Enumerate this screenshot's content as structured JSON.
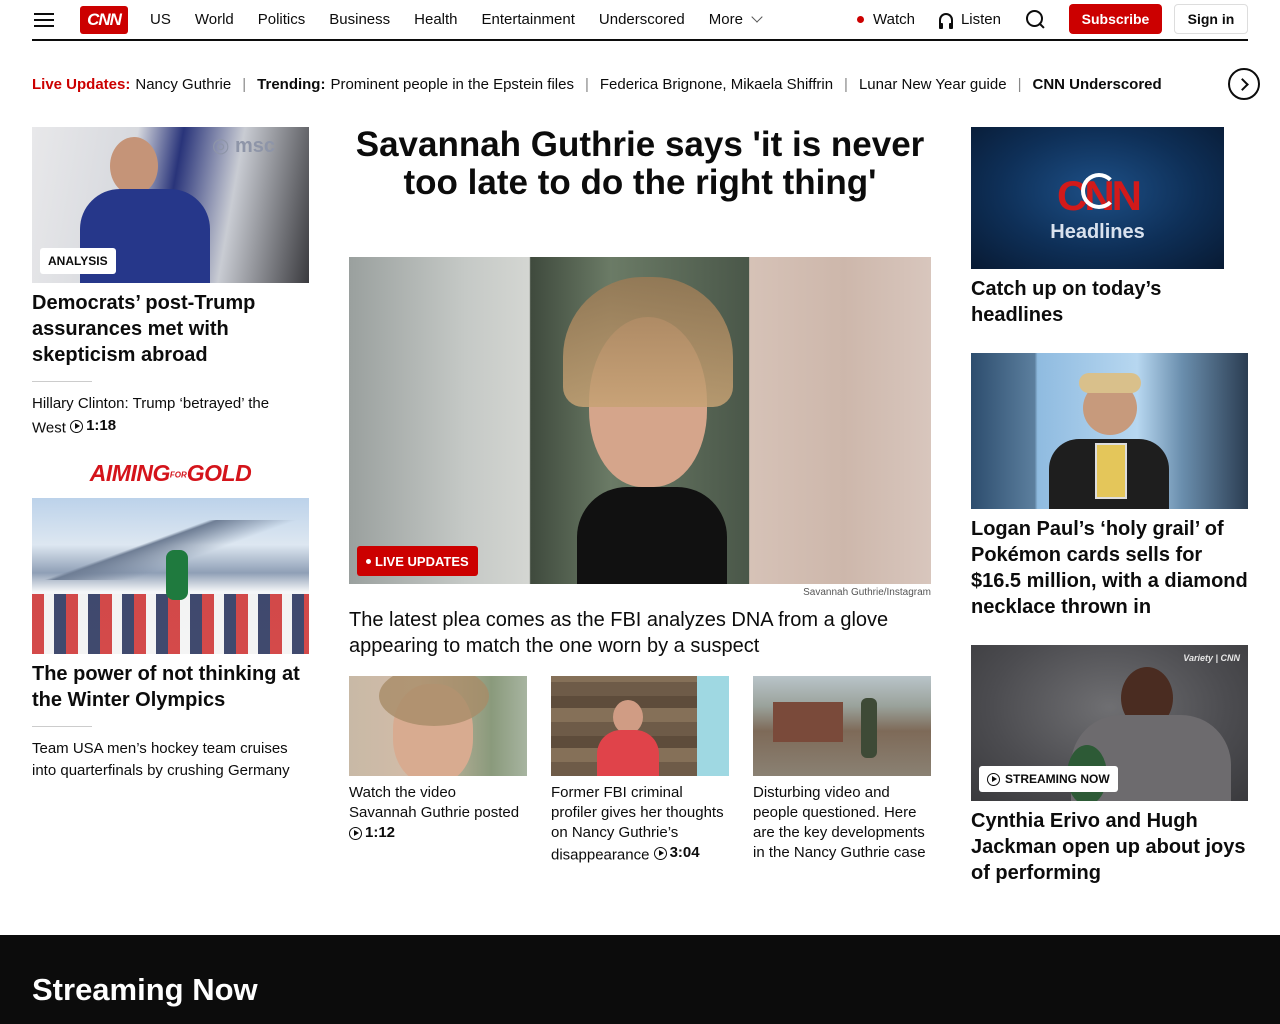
{
  "header": {
    "logo": "CNN",
    "nav": [
      "US",
      "World",
      "Politics",
      "Business",
      "Health",
      "Entertainment",
      "Underscored",
      "More"
    ],
    "watch": "Watch",
    "listen": "Listen",
    "subscribe": "Subscribe",
    "sign_in": "Sign in"
  },
  "ticker": {
    "live_label": "Live Updates:",
    "live_item": "Nancy Guthrie",
    "trending_label": "Trending:",
    "items": [
      "Prominent people in the Epstein files",
      "Federica Brignone, Mikaela Shiffrin",
      "Lunar New Year guide"
    ],
    "last_item": "CNN Underscored"
  },
  "left": {
    "story1": {
      "badge": "ANALYSIS",
      "headline": "Democrats’ post-Trump assurances met with skepticism abroad",
      "related": "Hillary Clinton: Trump ‘betrayed’ the West",
      "related_duration": "1:18"
    },
    "aiming": {
      "pre": "AIMING",
      "mid": "FOR",
      "post": "GOLD"
    },
    "story2": {
      "headline": "The power of not thinking at the Winter Olympics",
      "related": "Team USA men’s hockey team cruises into quarterfinals by crushing Germany"
    }
  },
  "center": {
    "headline": "Savannah Guthrie says 'it is never too late to do the right thing'",
    "live_badge": "LIVE UPDATES",
    "credit": "Savannah Guthrie/Instagram",
    "subheadline": "The latest plea comes as the FBI analyzes DNA from a glove appearing to match the one worn by a suspect",
    "thumbs": [
      {
        "caption": "Watch the video Savannah Guthrie posted",
        "duration": "1:12"
      },
      {
        "caption": "Former FBI criminal profiler gives her thoughts on Nancy Guthrie’s disappearance",
        "duration": "3:04"
      },
      {
        "caption": "Disturbing video and people questioned. Here are the key developments in the Nancy Guthrie case"
      }
    ]
  },
  "right": {
    "headlines_logo": "CNN",
    "headlines_label": "Headlines",
    "headlines_caption": "Catch up on today’s headlines",
    "story2": "Logan Paul’s ‘holy grail’ of Pokémon cards sells for $16.5 million, with a diamond necklace thrown in",
    "streaming_badge": "STREAMING NOW",
    "watermark": "Variety | CNN",
    "story3": "Cynthia Erivo and Hugh Jackman open up about joys of performing"
  },
  "footer_band": {
    "title": "Streaming Now"
  },
  "colors": {
    "brand": "#cc0000",
    "text": "#0c0c0c",
    "band": "#0c0c0c"
  }
}
